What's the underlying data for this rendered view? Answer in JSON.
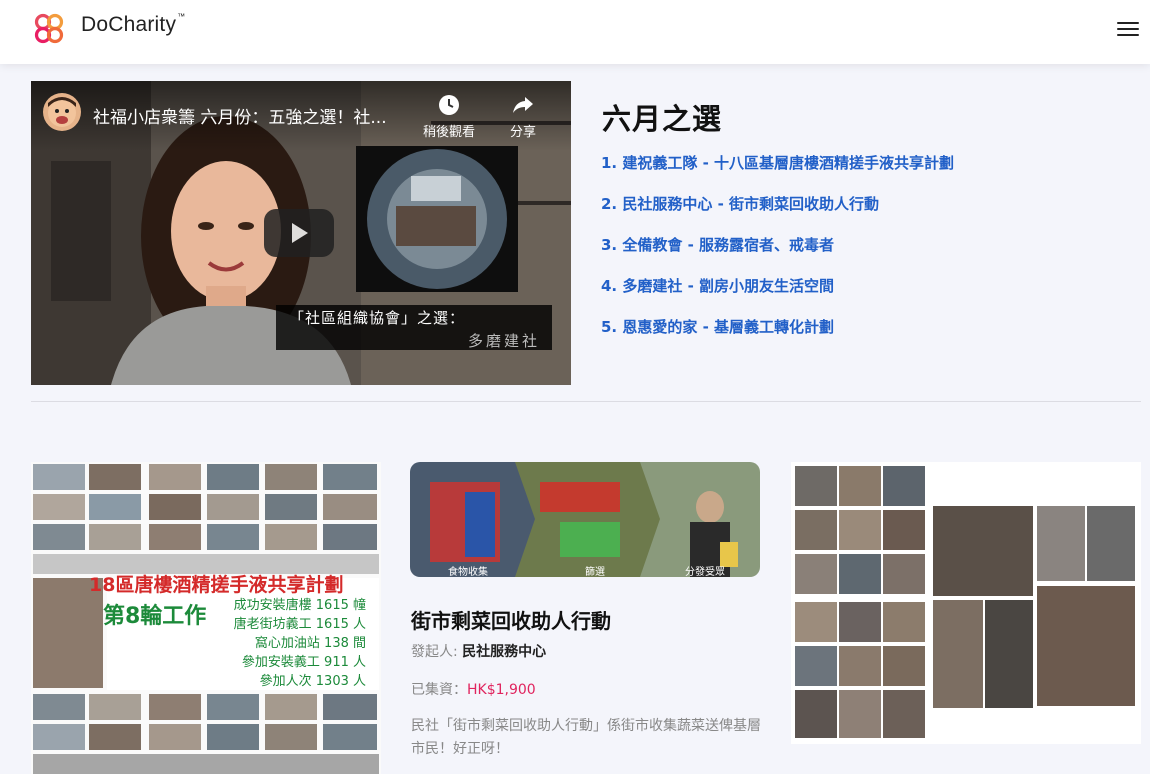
{
  "header": {
    "brand": "DoCharity",
    "trademark": "™",
    "brand_colors": [
      "#e84a5f",
      "#f39c3d",
      "#e91e63"
    ]
  },
  "video": {
    "title": "社福小店衆籌 六月份：五強之選！社...",
    "watch_later": "稍後觀看",
    "share": "分享",
    "caption_line1": "「社區組織協會」之選：",
    "caption_line2": "多磨建社"
  },
  "picks": {
    "title": "六月之選",
    "items": [
      "1. 建祝義工隊 - 十八區基層唐樓酒精搓手液共享計劃",
      "2. 民社服務中心 - 街市剩菜回收助人行動",
      "3. 全備教會 - 服務露宿者、戒毒者",
      "4. 多磨建社 - 劏房小朋友生活空間",
      "5. 恩惠愛的家 - 基層義工轉化計劃"
    ]
  },
  "card1": {
    "overlay_title": "18區唐樓酒精搓手液共享計劃",
    "overlay_round": "第8輪工作",
    "stats": [
      "成功安裝唐樓 1615 幢",
      "唐老街坊義工 1615 人",
      "窩心加油站 138 間",
      "參加安裝義工 911 人",
      "參加人次 1303 人"
    ]
  },
  "card2": {
    "img_labels": [
      "食物收集",
      "篩選",
      "分發受眾"
    ],
    "title": "街市剩菜回收助人行動",
    "organizer_label": "發起人: ",
    "organizer": "民社服務中心",
    "raised_label": "已集資：",
    "raised_amount": "HK$1,900",
    "description": "民社「街市剩菜回收助人行動」係街市收集蔬菜送俾基層市民！好正呀！",
    "accent_color": "#e0245e"
  }
}
